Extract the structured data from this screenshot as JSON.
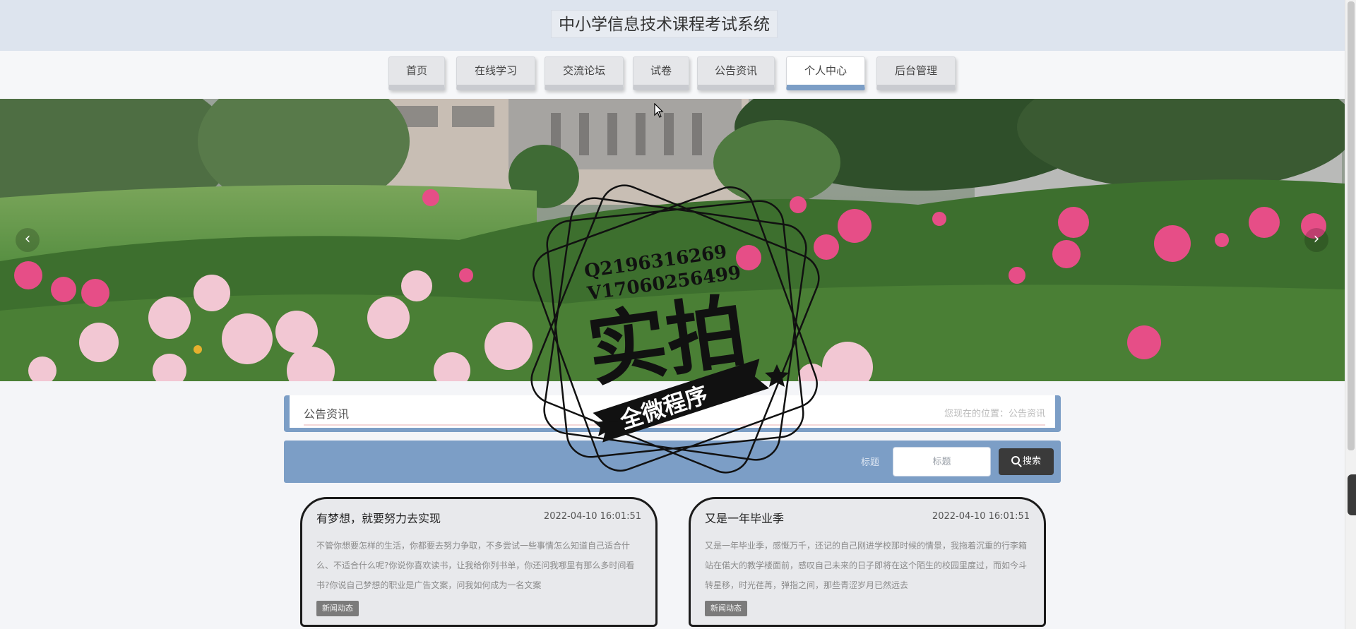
{
  "header": {
    "site_title": "中小学信息技术课程考试系统"
  },
  "nav": {
    "items": [
      {
        "label": "首页",
        "active": false
      },
      {
        "label": "在线学习",
        "active": false
      },
      {
        "label": "交流论坛",
        "active": false
      },
      {
        "label": "试卷",
        "active": false
      },
      {
        "label": "公告资讯",
        "active": false
      },
      {
        "label": "个人中心",
        "active": true
      },
      {
        "label": "后台管理",
        "active": false
      }
    ]
  },
  "banner": {
    "prev_icon": "chevron-left-icon",
    "prev_glyph": "‹",
    "next_icon": "chevron-right-icon",
    "next_glyph": "›"
  },
  "section": {
    "title": "公告资讯",
    "breadcrumb": "您现在的位置：公告资讯"
  },
  "search": {
    "label": "标题",
    "placeholder": "标题",
    "button_label": "搜索"
  },
  "news": [
    {
      "title": "有梦想，就要努力去实现",
      "date": "2022-04-10 16:01:51",
      "summary": "不管你想要怎样的生活，你都要去努力争取，不多尝试一些事情怎么知道自己适合什么、不适合什么呢?你说你喜欢读书，让我给你列书单，你还问我哪里有那么多时间看书?你说自己梦想的职业是广告文案，问我如何成为一名文案",
      "tag": "新闻动态"
    },
    {
      "title": "又是一年毕业季",
      "date": "2022-04-10 16:01:51",
      "summary": "又是一年毕业季，感慨万千，还记的自己刚进学校那时候的情景，我拖着沉重的行李箱站在偌大的教学楼面前，感叹自己未来的日子即将在这个陌生的校园里度过，而如今斗转星移，时光荏苒，弹指之间，那些青涩岁月已然远去",
      "tag": "新闻动态"
    }
  ],
  "watermark": {
    "contact_q": "Q2196316269",
    "contact_v": "V17060256499",
    "stamp_main": "实拍",
    "stamp_ribbon": "全微程序"
  },
  "colors": {
    "accent": "#7c9ec6",
    "header_bg": "#dde4ee",
    "button_dark": "#3a3a3a",
    "card_border": "#1b1b1b"
  }
}
